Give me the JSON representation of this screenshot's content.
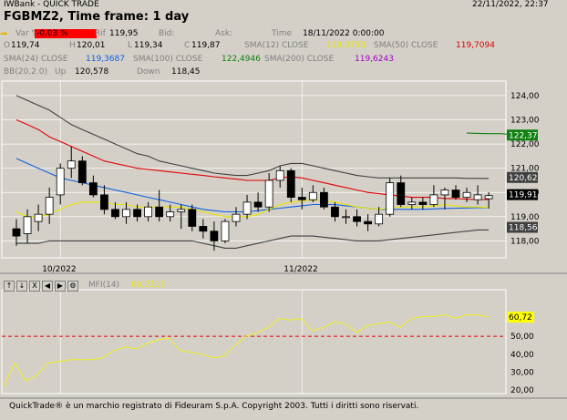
{
  "window": {
    "app_title": "IWBank - QUICK TRADE",
    "datetime": "22/11/2022, 22:37"
  },
  "instrument": {
    "title": "FGBMZ2, Time frame: 1 day"
  },
  "quote": {
    "var_label": "Var %",
    "var_value": "-0,03 %",
    "rif_label": "Rif",
    "rif_value": "119,95",
    "bid_label": "Bid:",
    "ask_label": "Ask:",
    "time_label": "Time",
    "time_value": "18/11/2022 0:00:00",
    "o_label": "O",
    "o_value": "119,74",
    "h_label": "H",
    "h_value": "120,01",
    "l_label": "L",
    "l_value": "119,34",
    "c_label": "C",
    "c_value": "119,87",
    "sma12_label": "SMA(12) CLOSE",
    "sma12_value": "119,3758",
    "sma50_label": "SMA(50) CLOSE",
    "sma50_value": "119,7094",
    "sma24_label": "SMA(24) CLOSE",
    "sma24_value": "119,3687",
    "sma100_label": "SMA(100) CLOSE",
    "sma100_value": "122,4946",
    "sma200_label": "SMA(200) CLOSE",
    "sma200_value": "119,6243",
    "bb_label": "BB(20,2.0)",
    "up_label": "Up",
    "up_value": "120,578",
    "down_label": "Down",
    "down_value": "118,45"
  },
  "mfi": {
    "label": "MFI(14)",
    "value": "60,7213",
    "tools": [
      "↑",
      "↓",
      "X",
      "◀",
      "▶",
      "⚙"
    ]
  },
  "colors": {
    "sma12": "#e6e600",
    "sma50": "#e00000",
    "sma24": "#1060e0",
    "sma100": "#108010",
    "sma200": "#a000c0",
    "bb": "#404040",
    "var_bg": "#ff0000",
    "mfi_line": "#f0f020"
  },
  "chart_data": [
    {
      "type": "candlestick",
      "title": "FGBMZ2, Time frame: 1 day",
      "ylim": [
        117.3,
        124.6
      ],
      "y_ticks": [
        118.0,
        119.0,
        120.0,
        121.0,
        122.0,
        123.0,
        124.0
      ],
      "y_tick_labels": [
        "118,00",
        "119,00",
        "120,00",
        "121,00",
        "122,00",
        "123,00",
        "124,00"
      ],
      "x_labels": [
        {
          "index": 4,
          "label": "10/2022"
        },
        {
          "index": 26,
          "label": "11/2022"
        }
      ],
      "candles": [
        {
          "o": 118.5,
          "h": 118.9,
          "l": 117.8,
          "c": 118.2
        },
        {
          "o": 118.3,
          "h": 119.3,
          "l": 117.9,
          "c": 119.0
        },
        {
          "o": 118.8,
          "h": 119.5,
          "l": 118.4,
          "c": 119.1
        },
        {
          "o": 119.1,
          "h": 120.2,
          "l": 118.7,
          "c": 119.8
        },
        {
          "o": 119.9,
          "h": 121.2,
          "l": 119.5,
          "c": 121.0
        },
        {
          "o": 121.0,
          "h": 121.9,
          "l": 120.6,
          "c": 121.3
        },
        {
          "o": 121.3,
          "h": 121.5,
          "l": 120.3,
          "c": 120.4
        },
        {
          "o": 120.4,
          "h": 120.7,
          "l": 119.8,
          "c": 119.9
        },
        {
          "o": 119.9,
          "h": 120.3,
          "l": 119.1,
          "c": 119.3
        },
        {
          "o": 119.3,
          "h": 119.6,
          "l": 118.9,
          "c": 119.0
        },
        {
          "o": 119.0,
          "h": 119.6,
          "l": 118.7,
          "c": 119.3
        },
        {
          "o": 119.3,
          "h": 119.5,
          "l": 118.8,
          "c": 119.0
        },
        {
          "o": 119.0,
          "h": 119.6,
          "l": 118.8,
          "c": 119.4
        },
        {
          "o": 119.4,
          "h": 120.1,
          "l": 118.8,
          "c": 119.0
        },
        {
          "o": 119.0,
          "h": 119.5,
          "l": 118.8,
          "c": 119.2
        },
        {
          "o": 119.2,
          "h": 119.5,
          "l": 118.5,
          "c": 119.3
        },
        {
          "o": 119.3,
          "h": 119.5,
          "l": 118.4,
          "c": 118.6
        },
        {
          "o": 118.6,
          "h": 118.9,
          "l": 118.1,
          "c": 118.4
        },
        {
          "o": 118.4,
          "h": 118.8,
          "l": 117.6,
          "c": 118.0
        },
        {
          "o": 118.0,
          "h": 118.9,
          "l": 117.9,
          "c": 118.8
        },
        {
          "o": 118.8,
          "h": 119.4,
          "l": 118.6,
          "c": 119.1
        },
        {
          "o": 119.1,
          "h": 119.9,
          "l": 118.9,
          "c": 119.6
        },
        {
          "o": 119.6,
          "h": 120.0,
          "l": 119.2,
          "c": 119.4
        },
        {
          "o": 119.4,
          "h": 120.8,
          "l": 119.2,
          "c": 120.5
        },
        {
          "o": 120.5,
          "h": 121.1,
          "l": 120.2,
          "c": 120.9
        },
        {
          "o": 120.9,
          "h": 121.0,
          "l": 119.6,
          "c": 119.8
        },
        {
          "o": 119.8,
          "h": 120.2,
          "l": 119.3,
          "c": 119.7
        },
        {
          "o": 119.7,
          "h": 120.3,
          "l": 119.6,
          "c": 120.0
        },
        {
          "o": 120.0,
          "h": 120.2,
          "l": 119.3,
          "c": 119.4
        },
        {
          "o": 119.4,
          "h": 119.6,
          "l": 118.8,
          "c": 119.0
        },
        {
          "o": 119.0,
          "h": 119.3,
          "l": 118.7,
          "c": 119.0
        },
        {
          "o": 119.0,
          "h": 119.3,
          "l": 118.6,
          "c": 118.8
        },
        {
          "o": 118.8,
          "h": 119.1,
          "l": 118.4,
          "c": 118.7
        },
        {
          "o": 118.7,
          "h": 119.4,
          "l": 118.6,
          "c": 119.1
        },
        {
          "o": 119.1,
          "h": 120.6,
          "l": 119.0,
          "c": 120.4
        },
        {
          "o": 120.4,
          "h": 120.7,
          "l": 119.4,
          "c": 119.5
        },
        {
          "o": 119.5,
          "h": 119.8,
          "l": 119.3,
          "c": 119.6
        },
        {
          "o": 119.6,
          "h": 119.8,
          "l": 119.3,
          "c": 119.5
        },
        {
          "o": 119.5,
          "h": 120.3,
          "l": 119.4,
          "c": 119.9
        },
        {
          "o": 119.9,
          "h": 120.2,
          "l": 119.3,
          "c": 120.1
        },
        {
          "o": 120.1,
          "h": 120.3,
          "l": 119.7,
          "c": 119.8
        },
        {
          "o": 119.8,
          "h": 120.2,
          "l": 119.6,
          "c": 120.0
        },
        {
          "o": 119.7,
          "h": 120.3,
          "l": 119.5,
          "c": 119.9
        },
        {
          "o": 119.74,
          "h": 120.01,
          "l": 119.34,
          "c": 119.87
        }
      ],
      "sma12": [
        119.2,
        119.0,
        119.0,
        119.1,
        119.3,
        119.5,
        119.6,
        119.6,
        119.6,
        119.5,
        119.5,
        119.4,
        119.4,
        119.4,
        119.4,
        119.4,
        119.3,
        119.2,
        119.1,
        119.0,
        119.0,
        119.0,
        119.1,
        119.3,
        119.5,
        119.6,
        119.65,
        119.7,
        119.65,
        119.6,
        119.5,
        119.4,
        119.35,
        119.3,
        119.35,
        119.4,
        119.4,
        119.4,
        119.45,
        119.5,
        119.45,
        119.4,
        119.4,
        119.38
      ],
      "sma50": [
        123.0,
        122.8,
        122.6,
        122.3,
        122.1,
        121.9,
        121.7,
        121.5,
        121.3,
        121.2,
        121.1,
        121.0,
        120.95,
        120.9,
        120.85,
        120.8,
        120.75,
        120.7,
        120.65,
        120.6,
        120.55,
        120.5,
        120.5,
        120.5,
        120.6,
        120.65,
        120.6,
        120.5,
        120.4,
        120.3,
        120.2,
        120.1,
        120.0,
        119.95,
        119.9,
        119.85,
        119.8,
        119.8,
        119.8,
        119.75,
        119.75,
        119.72,
        119.71,
        119.71
      ],
      "sma24": [
        121.4,
        121.2,
        121.0,
        120.8,
        120.6,
        120.5,
        120.4,
        120.3,
        120.2,
        120.1,
        120.0,
        119.9,
        119.8,
        119.7,
        119.6,
        119.5,
        119.4,
        119.3,
        119.25,
        119.2,
        119.2,
        119.2,
        119.25,
        119.3,
        119.35,
        119.4,
        119.45,
        119.5,
        119.5,
        119.5,
        119.45,
        119.4,
        119.35,
        119.3,
        119.3,
        119.3,
        119.3,
        119.3,
        119.32,
        119.34,
        119.35,
        119.36,
        119.37,
        119.37
      ],
      "bb_upper": [
        124.0,
        123.8,
        123.6,
        123.4,
        123.1,
        122.8,
        122.6,
        122.4,
        122.2,
        122.0,
        121.8,
        121.6,
        121.5,
        121.3,
        121.2,
        121.1,
        121.0,
        120.9,
        120.8,
        120.75,
        120.7,
        120.7,
        120.8,
        120.9,
        121.1,
        121.2,
        121.2,
        121.1,
        121.0,
        120.9,
        120.8,
        120.7,
        120.65,
        120.6,
        120.6,
        120.6,
        120.6,
        120.6,
        120.6,
        120.6,
        120.6,
        120.58,
        120.58,
        120.578
      ],
      "bb_lower": [
        117.9,
        117.9,
        117.9,
        118.0,
        118.0,
        118.0,
        118.0,
        118.0,
        118.0,
        118.0,
        118.0,
        118.0,
        118.0,
        118.0,
        118.0,
        118.0,
        118.0,
        117.9,
        117.8,
        117.7,
        117.7,
        117.8,
        117.9,
        118.0,
        118.1,
        118.2,
        118.2,
        118.2,
        118.15,
        118.1,
        118.05,
        118.0,
        118.0,
        118.0,
        118.05,
        118.1,
        118.15,
        118.2,
        118.25,
        118.3,
        118.35,
        118.4,
        118.45,
        118.45
      ],
      "sma100_tail": [
        122.45,
        122.44,
        122.43,
        122.43,
        122.4
      ],
      "price_tags": [
        {
          "value": 122.37,
          "label": "122,37",
          "bg": "#108010",
          "fg": "#ffffff"
        },
        {
          "value": 120.62,
          "label": "120,62",
          "bg": "#404040",
          "fg": "#ffffff"
        },
        {
          "value": 119.91,
          "label": "119,91",
          "bg": "#000000",
          "fg": "#ffffff"
        },
        {
          "value": 118.56,
          "label": "118,56",
          "bg": "#404040",
          "fg": "#ffffff"
        }
      ]
    },
    {
      "type": "line",
      "title": "MFI(14)",
      "ylim": [
        18,
        76
      ],
      "y_ticks": [
        20,
        30,
        40,
        50,
        60
      ],
      "y_tick_labels": [
        "20,00",
        "30,00",
        "40,00",
        "50,00",
        "60,00"
      ],
      "threshold": 50,
      "values": [
        22,
        35,
        25,
        28,
        35,
        36,
        37,
        37,
        37,
        38,
        42,
        44,
        43,
        46,
        48,
        49,
        42,
        41,
        40,
        38,
        39,
        45,
        50,
        52,
        55,
        60,
        59,
        60,
        53,
        55,
        58,
        57,
        52,
        56,
        57,
        58,
        55,
        60,
        61,
        61,
        62,
        60,
        62,
        62,
        60.72
      ],
      "current_label": "60,72"
    }
  ],
  "footer": {
    "text": "QuickTrade® è un marchio registrato di Fideuram S.p.A. Copyright 2003. Tutti i diritti sono riservati."
  }
}
